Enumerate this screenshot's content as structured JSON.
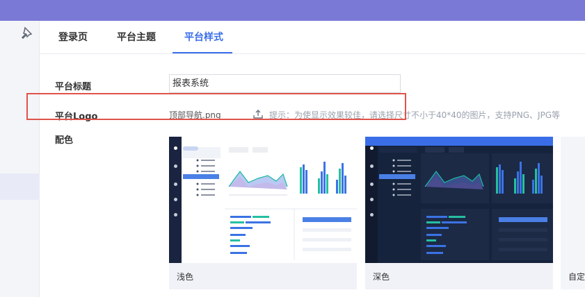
{
  "tabs": [
    {
      "label": "登录页"
    },
    {
      "label": "平台主题"
    },
    {
      "label": "平台样式"
    }
  ],
  "form": {
    "title_label": "平台标题",
    "title_value": "报表系统",
    "logo_label": "平台Logo",
    "logo_file": "顶部导航.png",
    "upload_hint": "提示：为使显示效果较佳，请选择尺寸不小于40*40的图片，支持PNG、JPG等",
    "color_label": "配色"
  },
  "themes": [
    {
      "label": "浅色"
    },
    {
      "label": "深色"
    },
    {
      "label": "自定"
    }
  ],
  "colors": {
    "accent": "#3a6ee8",
    "header": "#7a79d6",
    "highlight_border": "#e0534a"
  }
}
